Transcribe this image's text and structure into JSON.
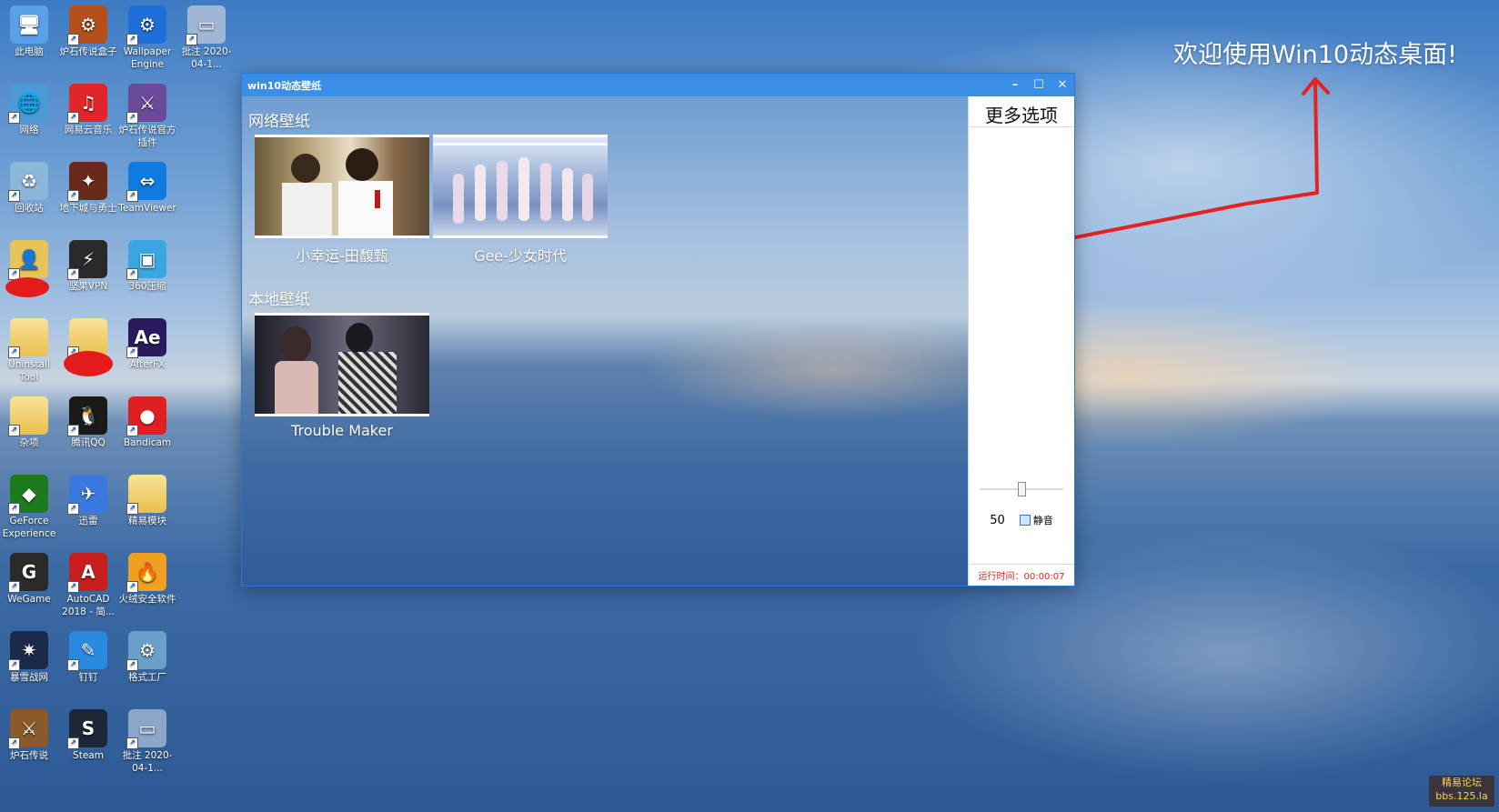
{
  "desktop": {
    "icons": [
      {
        "label": "此电脑",
        "color": "#5aa0e8",
        "glyph": "🖥"
      },
      {
        "label": "炉石传说盒子",
        "color": "#b5501c",
        "glyph": "⚙"
      },
      {
        "label": "Wallpaper Engine",
        "color": "#1e6fd9",
        "glyph": "⚙"
      },
      {
        "label": "批注 2020-04-1...",
        "color": "#9fb7d4",
        "glyph": "▭"
      },
      {
        "label": "网络",
        "color": "#4a9ad8",
        "glyph": "🌐"
      },
      {
        "label": "网易云音乐",
        "color": "#e0262a",
        "glyph": "♫"
      },
      {
        "label": "炉石传说官方插件",
        "color": "#6b4a9a",
        "glyph": "⚔"
      },
      {
        "label": "回收站",
        "color": "#8ab6da",
        "glyph": "♻"
      },
      {
        "label": "地下城与勇士",
        "color": "#6a2a1a",
        "glyph": "✦"
      },
      {
        "label": "TeamViewer",
        "color": "#0e7be0",
        "glyph": "⇔"
      },
      {
        "label": "",
        "color": "#e6c45a",
        "glyph": "👤"
      },
      {
        "label": "坚果VPN",
        "color": "#2a2a2a",
        "glyph": "⚡"
      },
      {
        "label": "360压缩",
        "color": "#3aa6e0",
        "glyph": "▣"
      },
      {
        "label": "Uninstall Tool",
        "color": "#e9c45a",
        "glyph": "▤"
      },
      {
        "label": "",
        "color": "#e9c45a",
        "glyph": "▤"
      },
      {
        "label": "AfterFX",
        "color": "#2a1a5e",
        "glyph": "Ae"
      },
      {
        "label": "杂项",
        "color": "#e9c45a",
        "glyph": "▤"
      },
      {
        "label": "腾讯QQ",
        "color": "#1a1a1a",
        "glyph": "🐧"
      },
      {
        "label": "Bandicam",
        "color": "#e02020",
        "glyph": "●"
      },
      {
        "label": "GeForce Experience",
        "color": "#1e7a1e",
        "glyph": "◆"
      },
      {
        "label": "迅雷",
        "color": "#3a7ae0",
        "glyph": "✈"
      },
      {
        "label": "精易模块",
        "color": "#e9c45a",
        "glyph": "▤"
      },
      {
        "label": "WeGame",
        "color": "#2a2a2a",
        "glyph": "G"
      },
      {
        "label": "AutoCAD 2018 - 简...",
        "color": "#c81e1e",
        "glyph": "A"
      },
      {
        "label": "火绒安全软件",
        "color": "#f0a020",
        "glyph": "🔥"
      },
      {
        "label": "暴雪战网",
        "color": "#1a2a4a",
        "glyph": "✷"
      },
      {
        "label": "钉钉",
        "color": "#2a8ae0",
        "glyph": "✎"
      },
      {
        "label": "格式工厂",
        "color": "#6aa0c8",
        "glyph": "⚙"
      },
      {
        "label": "炉石传说",
        "color": "#8a5a2a",
        "glyph": "⚔"
      },
      {
        "label": "Steam",
        "color": "#1b2838",
        "glyph": "S"
      },
      {
        "label": "批注 2020-04-1...",
        "color": "#8aa6c8",
        "glyph": "▭"
      }
    ]
  },
  "window": {
    "title": "win10动态壁纸",
    "minimize": "–",
    "maximize": "☐",
    "close": "✕"
  },
  "gallery": {
    "network_title": "网络壁纸",
    "local_title": "本地壁纸",
    "network_items": [
      {
        "label": "小幸运-田馥甄"
      },
      {
        "label": "Gee-少女时代"
      }
    ],
    "local_items": [
      {
        "label": "Trouble Maker"
      }
    ]
  },
  "side_panel": {
    "title": "更多选项",
    "volume_value": "50",
    "volume_level": 0.5,
    "mute_label": "静音",
    "runtime": "运行时间：00:00:07"
  },
  "overlay": {
    "welcome": "欢迎使用Win10动态桌面!",
    "arrow_color": "#e32222",
    "watermark": "精易论坛 bbs.125.la"
  }
}
